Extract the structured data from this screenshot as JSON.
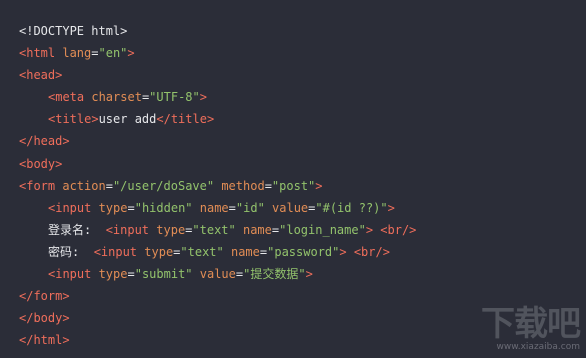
{
  "code_lines": [
    {
      "indent": 0,
      "tokens": [
        [
          "txt",
          "<!DOCTYPE html>"
        ]
      ]
    },
    {
      "indent": 0,
      "tokens": [
        [
          "tag",
          "<html "
        ],
        [
          "attr",
          "lang"
        ],
        [
          "txt",
          "="
        ],
        [
          "str",
          "\"en\""
        ],
        [
          "tag",
          ">"
        ]
      ]
    },
    {
      "indent": 0,
      "tokens": [
        [
          "tag",
          "<head>"
        ]
      ]
    },
    {
      "indent": 1,
      "tokens": [
        [
          "tag",
          "<meta "
        ],
        [
          "attr",
          "charset"
        ],
        [
          "txt",
          "="
        ],
        [
          "str",
          "\"UTF-8\""
        ],
        [
          "tag",
          ">"
        ]
      ]
    },
    {
      "indent": 1,
      "tokens": [
        [
          "tag",
          "<title>"
        ],
        [
          "txt",
          "user add"
        ],
        [
          "tag",
          "</title>"
        ]
      ]
    },
    {
      "indent": 0,
      "tokens": [
        [
          "tag",
          "</head>"
        ]
      ]
    },
    {
      "indent": 0,
      "tokens": [
        [
          "tag",
          "<body>"
        ]
      ]
    },
    {
      "indent": 0,
      "tokens": [
        [
          "tag",
          "<form "
        ],
        [
          "attr",
          "action"
        ],
        [
          "txt",
          "="
        ],
        [
          "str",
          "\"/user/doSave\" "
        ],
        [
          "attr",
          "method"
        ],
        [
          "txt",
          "="
        ],
        [
          "str",
          "\"post\""
        ],
        [
          "tag",
          ">"
        ]
      ]
    },
    {
      "indent": 1,
      "tokens": [
        [
          "tag",
          "<input "
        ],
        [
          "attr",
          "type"
        ],
        [
          "txt",
          "="
        ],
        [
          "str",
          "\"hidden\" "
        ],
        [
          "attr",
          "name"
        ],
        [
          "txt",
          "="
        ],
        [
          "str",
          "\"id\" "
        ],
        [
          "attr",
          "value"
        ],
        [
          "txt",
          "="
        ],
        [
          "str",
          "\"#(id ??)\""
        ],
        [
          "tag",
          ">"
        ]
      ]
    },
    {
      "indent": 1,
      "tokens": [
        [
          "txt",
          "登录名:  "
        ],
        [
          "tag",
          "<input "
        ],
        [
          "attr",
          "type"
        ],
        [
          "txt",
          "="
        ],
        [
          "str",
          "\"text\" "
        ],
        [
          "attr",
          "name"
        ],
        [
          "txt",
          "="
        ],
        [
          "str",
          "\"login_name\""
        ],
        [
          "tag",
          "> <br/>"
        ]
      ]
    },
    {
      "indent": 1,
      "tokens": [
        [
          "txt",
          "密码:  "
        ],
        [
          "tag",
          "<input "
        ],
        [
          "attr",
          "type"
        ],
        [
          "txt",
          "="
        ],
        [
          "str",
          "\"text\" "
        ],
        [
          "attr",
          "name"
        ],
        [
          "txt",
          "="
        ],
        [
          "str",
          "\"password\""
        ],
        [
          "tag",
          "> <br/>"
        ]
      ]
    },
    {
      "indent": 1,
      "tokens": [
        [
          "tag",
          "<input "
        ],
        [
          "attr",
          "type"
        ],
        [
          "txt",
          "="
        ],
        [
          "str",
          "\"submit\" "
        ],
        [
          "attr",
          "value"
        ],
        [
          "txt",
          "="
        ],
        [
          "str",
          "\"提交数据\""
        ],
        [
          "tag",
          ">"
        ]
      ]
    },
    {
      "indent": 0,
      "tokens": [
        [
          "tag",
          "</form>"
        ]
      ]
    },
    {
      "indent": 0,
      "tokens": [
        [
          "tag",
          "</body>"
        ]
      ]
    },
    {
      "indent": 0,
      "tokens": [
        [
          "tag",
          "</html>"
        ]
      ]
    }
  ],
  "watermark": {
    "main": "下载吧",
    "sub": "www.xiazaiba.com"
  }
}
